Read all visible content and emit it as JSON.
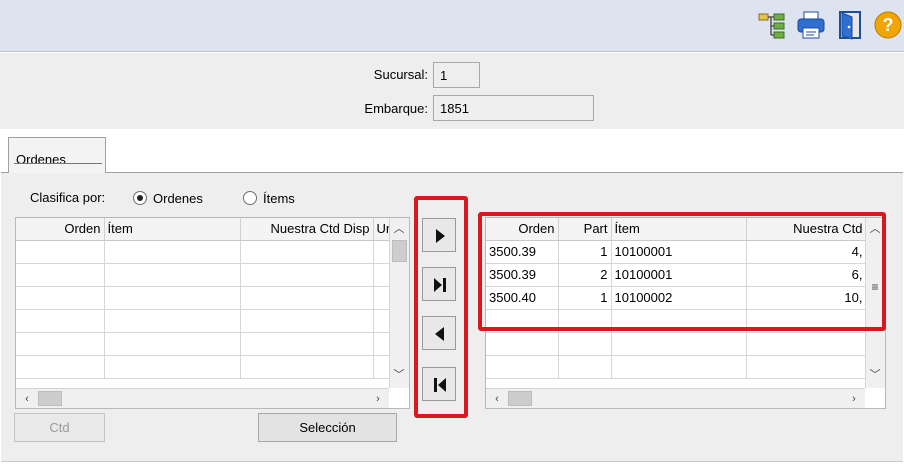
{
  "toolbar": {
    "icons": [
      "tree-hierarchy-icon",
      "printer-icon",
      "exit-door-icon",
      "help-icon"
    ]
  },
  "header": {
    "sucursal_label": "Sucursal:",
    "sucursal_value": "1",
    "embarque_label": "Embarque:",
    "embarque_value": "1851"
  },
  "tabs": [
    {
      "label": "Ordenes"
    }
  ],
  "classify": {
    "label": "Clasifica por:",
    "options": [
      "Ordenes",
      "Ítems"
    ],
    "selected": "Ordenes"
  },
  "left_grid": {
    "columns": [
      "Orden",
      "Ítem",
      "Nuestra Ctd Disp",
      "Ur"
    ],
    "rows": []
  },
  "right_grid": {
    "columns": [
      "Orden",
      "Part",
      "Ítem",
      "Nuestra Ctd"
    ],
    "rows": [
      [
        "3500.39",
        "1",
        "10100001",
        "4,"
      ],
      [
        "3500.39",
        "2",
        "10100001",
        "6,"
      ],
      [
        "3500.40",
        "1",
        "10100002",
        "10,"
      ]
    ]
  },
  "transfer_buttons": [
    "move-right",
    "move-all-right",
    "move-left",
    "move-all-left"
  ],
  "buttons": {
    "ctd_label": "Ctd",
    "seleccion_label": "Selección"
  },
  "colors": {
    "highlight": "#d7191f",
    "topbar": "#dde3ef",
    "panel": "#eeeeee"
  }
}
